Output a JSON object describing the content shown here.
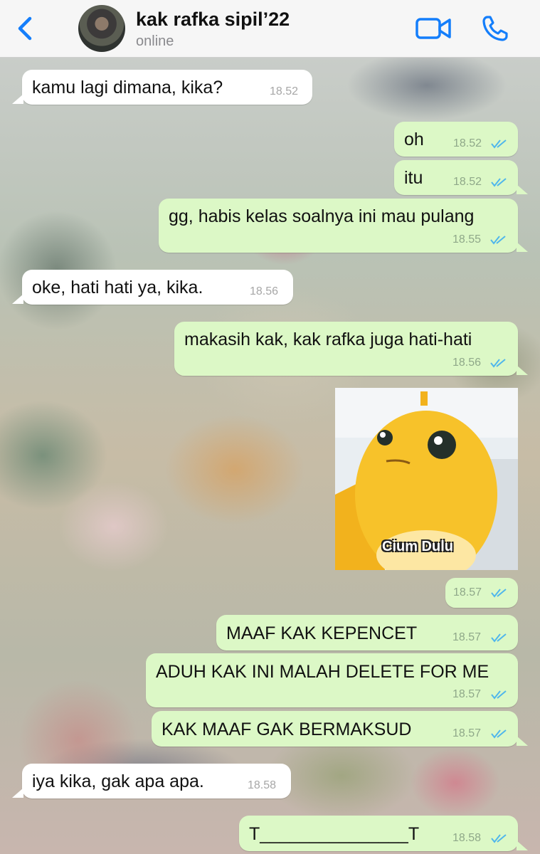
{
  "header": {
    "contact_name": "kak rafka sipil’22",
    "status": "online"
  },
  "messages": [
    {
      "dir": "in",
      "text": "kamu lagi dimana, kika?",
      "time": "18.52"
    },
    {
      "dir": "out",
      "text": "oh",
      "time": "18.52",
      "read": true
    },
    {
      "dir": "out",
      "text": "itu",
      "time": "18.52",
      "read": true
    },
    {
      "dir": "out",
      "text": "gg, habis kelas soalnya ini mau pulang",
      "time": "18.55",
      "read": true
    },
    {
      "dir": "in",
      "text": "oke, hati hati ya, kika.",
      "time": "18.56"
    },
    {
      "dir": "out",
      "text": "makasih kak, kak rafka juga hati-hati",
      "time": "18.56",
      "read": true
    },
    {
      "dir": "out",
      "type": "sticker",
      "caption": "Cium Dulu",
      "time": "18.57",
      "read": true
    },
    {
      "dir": "out",
      "text": "MAAF KAK KEPENCET",
      "time": "18.57",
      "read": true
    },
    {
      "dir": "out",
      "text": "ADUH KAK INI MALAH DELETE FOR ME",
      "time": "18.57",
      "read": true
    },
    {
      "dir": "out",
      "text": "KAK MAAF GAK BERMAKSUD",
      "time": "18.57",
      "read": true
    },
    {
      "dir": "in",
      "text": "iya kika, gak apa apa.",
      "time": "18.58"
    },
    {
      "dir": "out",
      "text": "T_______________T",
      "time": "18.58",
      "read": true
    }
  ],
  "colors": {
    "accent": "#147efb",
    "incoming_bubble": "#ffffff",
    "outgoing_bubble": "#dcf8c6",
    "read_ticks": "#4fb6ec"
  },
  "icons": [
    "back-chevron-icon",
    "video-call-icon",
    "phone-icon",
    "read-receipt-icon"
  ]
}
